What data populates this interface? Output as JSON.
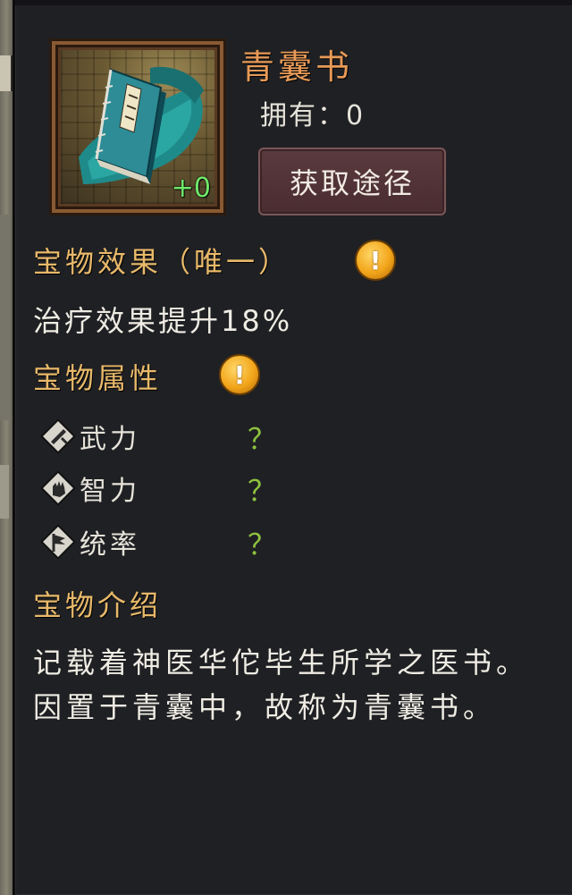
{
  "item": {
    "name": "青囊书",
    "owned_label": "拥有",
    "owned_sep": "：",
    "owned_count": "0",
    "level": "+0",
    "icon": "blue-book-icon"
  },
  "actions": {
    "obtain_label": "获取途径"
  },
  "effect": {
    "heading": "宝物效果（唯一）",
    "text": "治疗效果提升18%"
  },
  "attributes": {
    "heading": "宝物属性",
    "items": [
      {
        "label": "武力",
        "value": "？",
        "icon": "sword-icon"
      },
      {
        "label": "智力",
        "value": "？",
        "icon": "hand-icon"
      },
      {
        "label": "统率",
        "value": "？",
        "icon": "flag-icon"
      }
    ]
  },
  "intro": {
    "heading": "宝物介绍",
    "text": "记载着神医华佗毕生所学之医书。因置于青囊中，故称为青囊书。"
  },
  "colors": {
    "panel_bg": "#1f2023",
    "title": "#e89a57",
    "heading": "#e8b96a",
    "unknown_value": "#8ec23e",
    "level": "#6fe86a"
  }
}
